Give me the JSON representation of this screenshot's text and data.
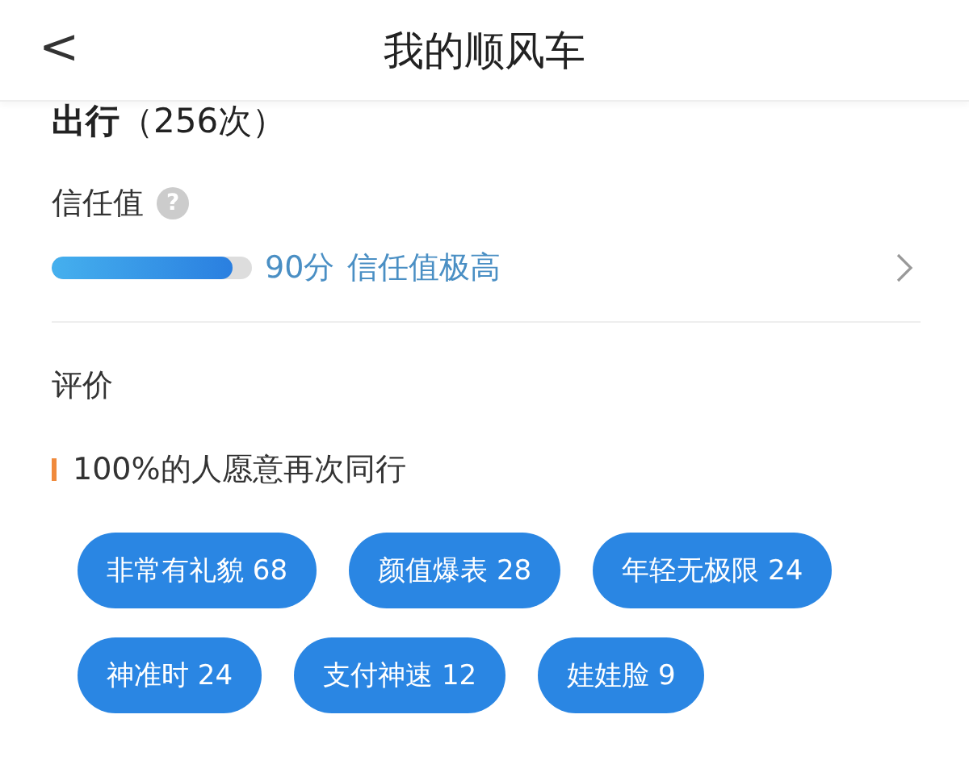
{
  "header": {
    "back": "<",
    "title": "我的顺风车"
  },
  "trips": {
    "label": "出行",
    "count": "（256次）"
  },
  "trust": {
    "label": "信任值",
    "help": "?",
    "level": 0.9,
    "score": "90分",
    "rating": "信任值极高"
  },
  "reviews": {
    "title": "评价",
    "summary": "100%的人愿意再次同行",
    "tags": [
      {
        "label": "非常有礼貌 68"
      },
      {
        "label": "颜值爆表 28"
      },
      {
        "label": "年轻无极限 24"
      },
      {
        "label": "神准时 24"
      },
      {
        "label": "支付神速 12"
      },
      {
        "label": "娃娃脸 9"
      }
    ]
  }
}
